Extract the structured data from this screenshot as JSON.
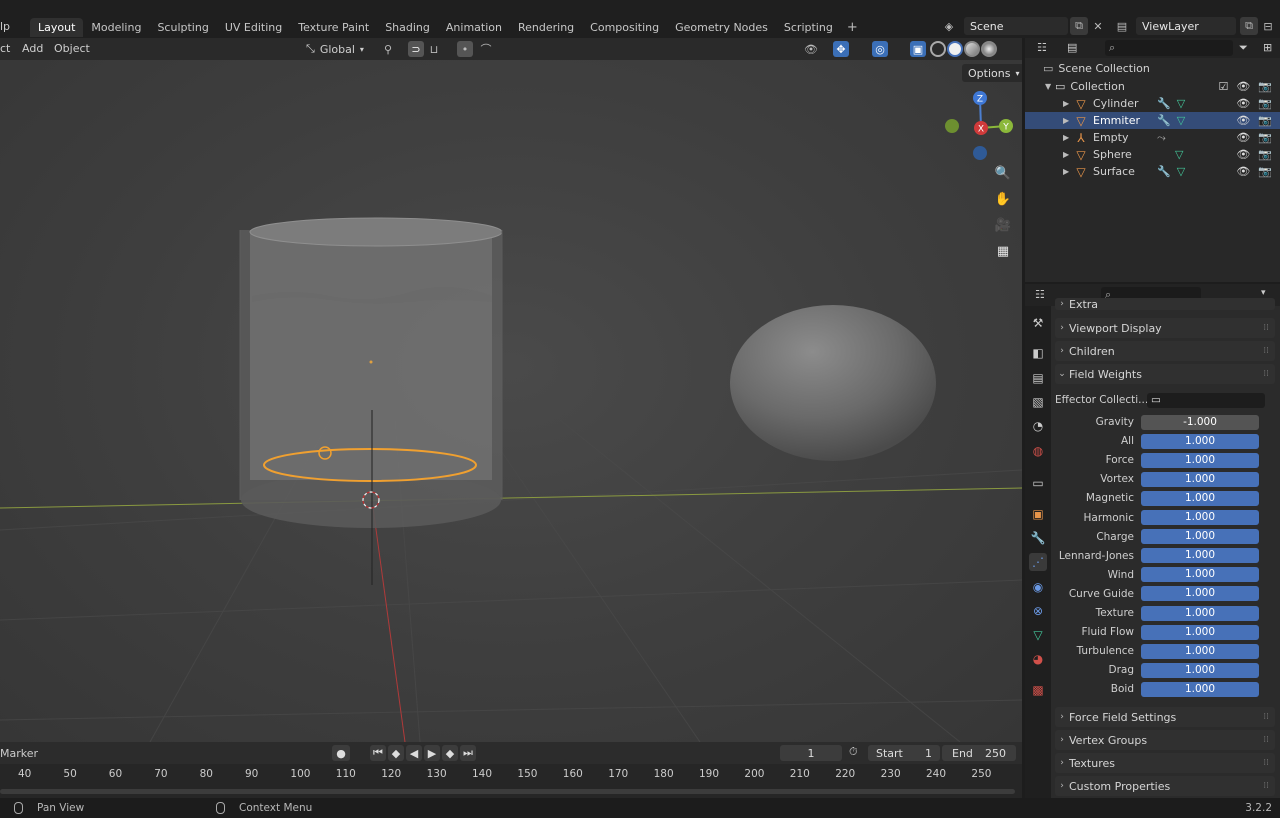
{
  "workspace": {
    "help_label": "lp",
    "tabs": [
      "Layout",
      "Modeling",
      "Sculpting",
      "UV Editing",
      "Texture Paint",
      "Shading",
      "Animation",
      "Rendering",
      "Compositing",
      "Geometry Nodes",
      "Scripting"
    ],
    "active_tab": "Layout",
    "add_symbol": "+",
    "scene_name": "Scene",
    "view_layer": "ViewLayer"
  },
  "viewport_header": {
    "menus": [
      "ct",
      "Add",
      "Object"
    ],
    "transform_orientation": "Global",
    "options_label": "Options"
  },
  "gizmo": {
    "z": "Z",
    "x": "X",
    "y": "Y"
  },
  "outliner": {
    "scene_collection": "Scene Collection",
    "collection": "Collection",
    "items": [
      {
        "name": "Cylinder",
        "modifier": true,
        "mesh": true,
        "selected": false
      },
      {
        "name": "Emmiter",
        "modifier": true,
        "mesh": true,
        "selected": true
      },
      {
        "name": "Empty",
        "modifier": false,
        "mesh": false,
        "selected": false
      },
      {
        "name": "Sphere",
        "modifier": false,
        "mesh": true,
        "selected": false
      },
      {
        "name": "Surface",
        "modifier": true,
        "mesh": true,
        "selected": false
      }
    ]
  },
  "properties": {
    "panels_top": [
      "Extra",
      "Viewport Display",
      "Children",
      "Field Weights"
    ],
    "effector_label": "Effector Collecti...",
    "field_weights": [
      {
        "label": "Gravity",
        "value": "-1.000"
      },
      {
        "label": "All",
        "value": "1.000"
      },
      {
        "label": "Force",
        "value": "1.000"
      },
      {
        "label": "Vortex",
        "value": "1.000"
      },
      {
        "label": "Magnetic",
        "value": "1.000"
      },
      {
        "label": "Harmonic",
        "value": "1.000"
      },
      {
        "label": "Charge",
        "value": "1.000"
      },
      {
        "label": "Lennard-Jones",
        "value": "1.000"
      },
      {
        "label": "Wind",
        "value": "1.000"
      },
      {
        "label": "Curve Guide",
        "value": "1.000"
      },
      {
        "label": "Texture",
        "value": "1.000"
      },
      {
        "label": "Fluid Flow",
        "value": "1.000"
      },
      {
        "label": "Turbulence",
        "value": "1.000"
      },
      {
        "label": "Drag",
        "value": "1.000"
      },
      {
        "label": "Boid",
        "value": "1.000"
      }
    ],
    "panels_bottom": [
      "Force Field Settings",
      "Vertex Groups",
      "Textures",
      "Custom Properties"
    ]
  },
  "timeline": {
    "marker_label": "Marker",
    "current_frame": "1",
    "start_label": "Start",
    "start_value": "1",
    "end_label": "End",
    "end_value": "250",
    "ruler": [
      "40",
      "50",
      "60",
      "70",
      "80",
      "90",
      "100",
      "110",
      "120",
      "130",
      "140",
      "150",
      "160",
      "170",
      "180",
      "190",
      "200",
      "210",
      "220",
      "230",
      "240",
      "250"
    ]
  },
  "status": {
    "pan_view": "Pan View",
    "context_menu": "Context Menu",
    "version": "3.2.2"
  },
  "colors": {
    "accent": "#4771b8",
    "selection_outline": "#f0a030",
    "object_icon": "#e8954a",
    "mesh_icon": "#43c79a"
  }
}
